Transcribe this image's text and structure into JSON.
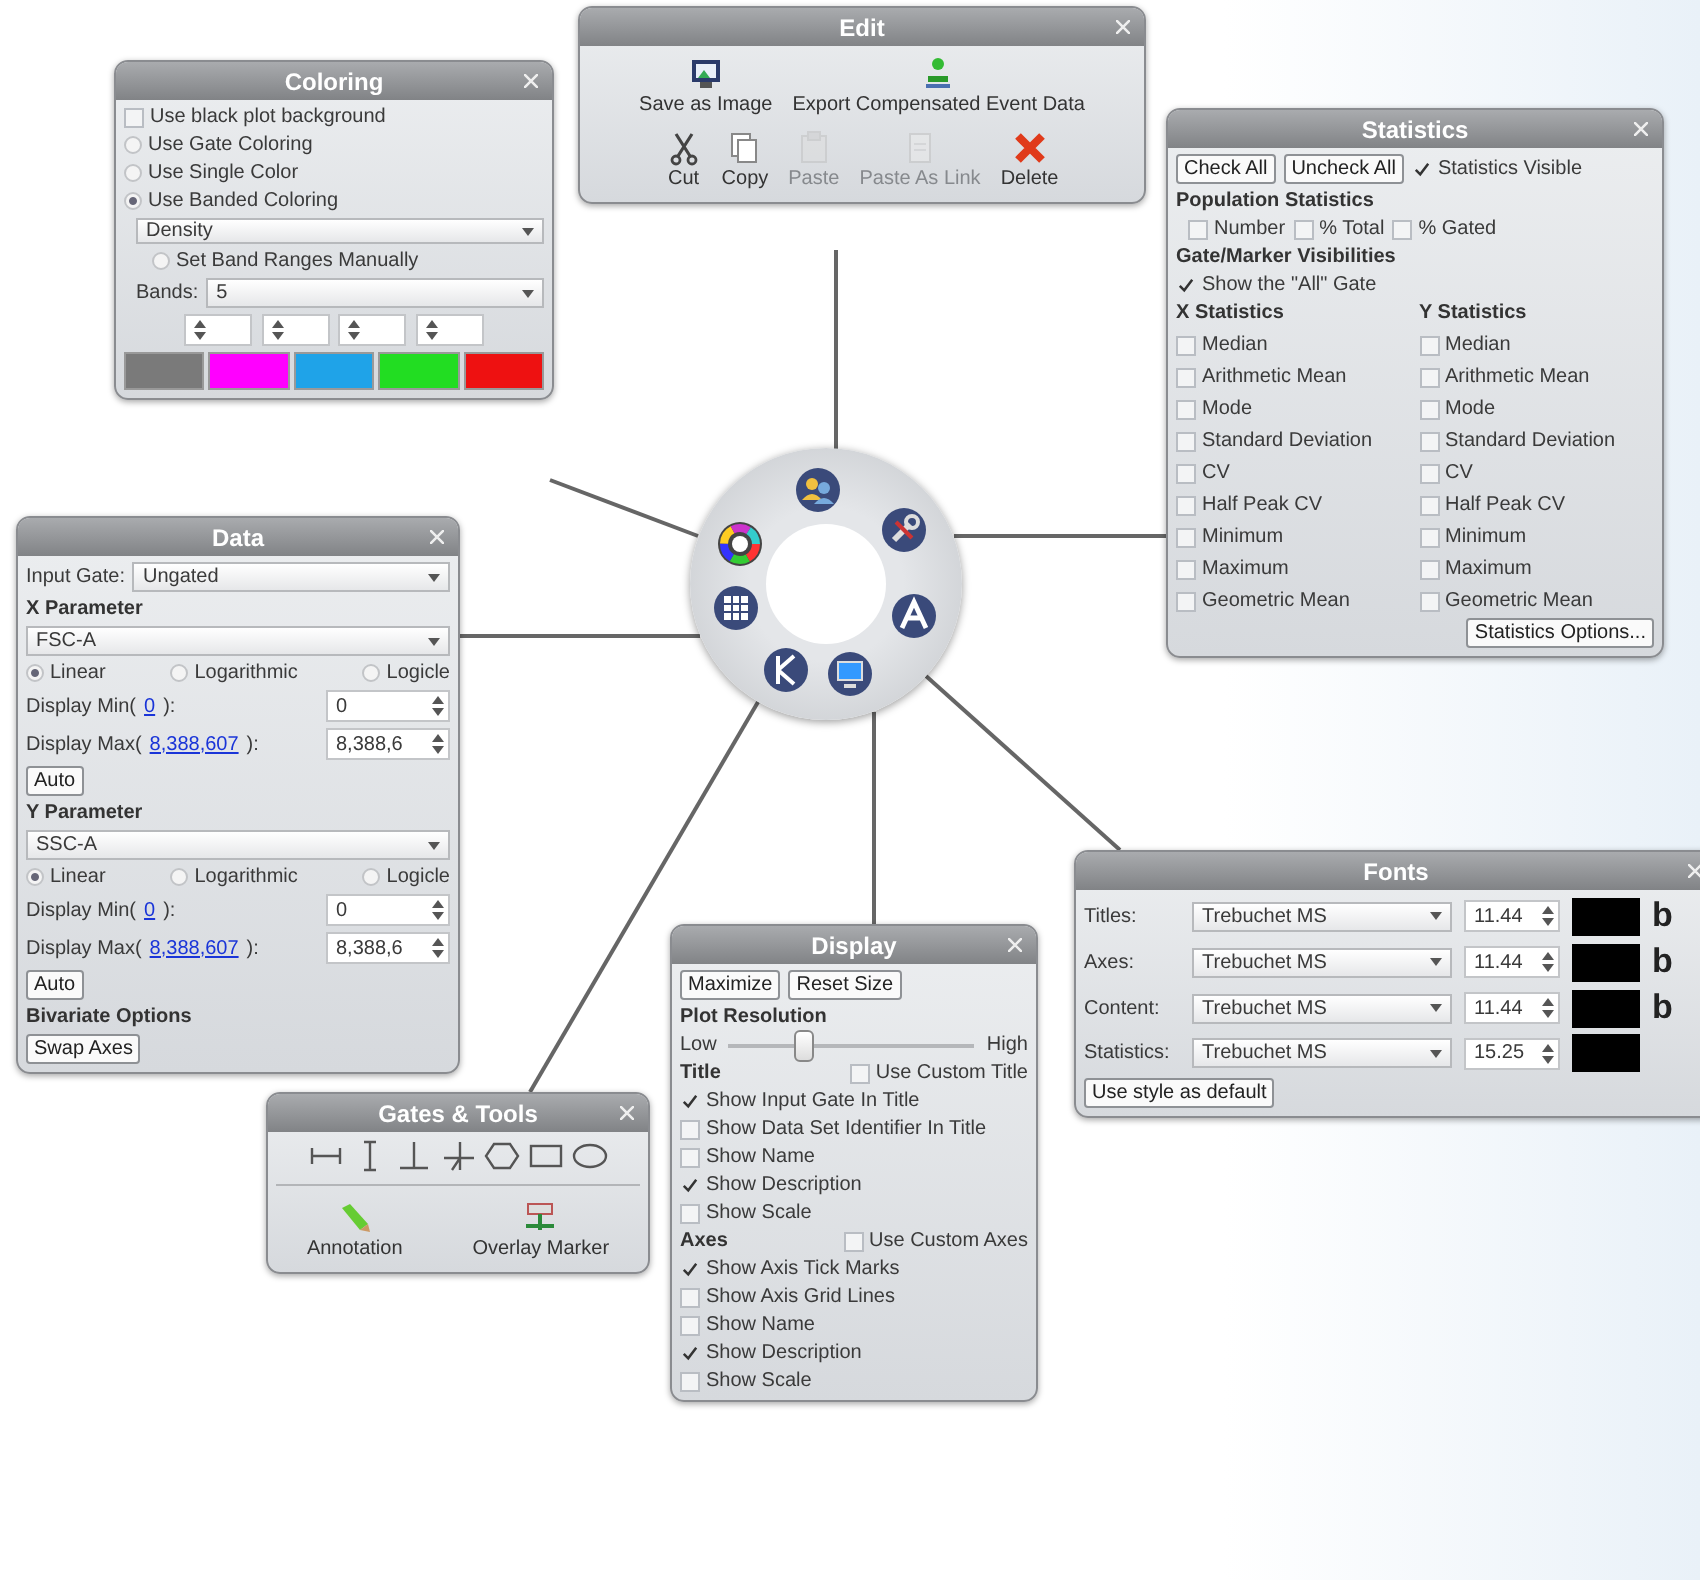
{
  "panels": [
    {
      "kind": "edit",
      "title": "Edit",
      "groups": [
        {
          "actions": [
            {
              "kind": "image",
              "label": "Save as Image",
              "disabled": false
            },
            {
              "kind": "export",
              "label": "Export Compensated Event Data",
              "disabled": false
            }
          ]
        },
        {
          "actions": [
            {
              "kind": "cut",
              "label": "Cut",
              "disabled": false
            },
            {
              "kind": "copy",
              "label": "Copy",
              "disabled": false
            },
            {
              "kind": "paste",
              "label": "Paste",
              "disabled": true
            },
            {
              "kind": "link",
              "label": "Paste As Link",
              "disabled": true
            },
            {
              "kind": "delete",
              "label": "Delete",
              "disabled": false
            }
          ]
        }
      ]
    },
    {
      "kind": "coloring",
      "title": "Coloring",
      "options": [
        {
          "kind": "checkbox",
          "label": "Use black plot background",
          "checked": false
        },
        {
          "kind": "radio",
          "label": "Use Gate Coloring",
          "selected": false
        },
        {
          "kind": "radio",
          "label": "Use Single Color",
          "selected": false
        },
        {
          "kind": "radio",
          "label": "Use Banded Coloring",
          "selected": true
        }
      ],
      "band_type": "Density",
      "manual": {
        "kind": "radio",
        "label": "Set Band Ranges Manually",
        "selected": false
      },
      "bands_label": "Bands:",
      "bands_value": "5",
      "swatches": [
        {
          "color": "#7a7a7a"
        },
        {
          "color": "#ff00ff"
        },
        {
          "color": "#1fa3e8"
        },
        {
          "color": "#22dd22"
        },
        {
          "color": "#ee1111"
        }
      ]
    },
    {
      "kind": "statistics",
      "title": "Statistics",
      "buttons": [
        "Check All",
        "Uncheck All"
      ],
      "visible": {
        "label": "Statistics Visible",
        "checked": true
      },
      "population": {
        "heading": "Population Statistics",
        "items": [
          {
            "label": "Number",
            "checked": false
          },
          {
            "label": "% Total",
            "checked": false
          },
          {
            "label": "% Gated",
            "checked": false
          }
        ]
      },
      "gates": {
        "heading": "Gate/Marker Visibilities",
        "items": [
          {
            "label": "Show the \"All\" Gate",
            "checked": true
          }
        ]
      },
      "columns": [
        {
          "heading": "X Statistics",
          "items": [
            {
              "label": "Median",
              "checked": false
            },
            {
              "label": "Arithmetic Mean",
              "checked": false
            },
            {
              "label": "Mode",
              "checked": false
            },
            {
              "label": "Standard Deviation",
              "checked": false
            },
            {
              "label": "CV",
              "checked": false
            },
            {
              "label": "Half Peak CV",
              "checked": false
            },
            {
              "label": "Minimum",
              "checked": false
            },
            {
              "label": "Maximum",
              "checked": false
            },
            {
              "label": "Geometric Mean",
              "checked": false
            }
          ]
        },
        {
          "heading": "Y Statistics",
          "items": [
            {
              "label": "Median",
              "checked": false
            },
            {
              "label": "Arithmetic Mean",
              "checked": false
            },
            {
              "label": "Mode",
              "checked": false
            },
            {
              "label": "Standard Deviation",
              "checked": false
            },
            {
              "label": "CV",
              "checked": false
            },
            {
              "label": "Half Peak CV",
              "checked": false
            },
            {
              "label": "Minimum",
              "checked": false
            },
            {
              "label": "Maximum",
              "checked": false
            },
            {
              "label": "Geometric Mean",
              "checked": false
            }
          ]
        }
      ],
      "options_button": "Statistics Options..."
    },
    {
      "kind": "data",
      "title": "Data",
      "input_gate": {
        "label": "Input Gate:",
        "value": "Ungated"
      },
      "parameters": [
        {
          "heading": "X Parameter",
          "value": "FSC-A",
          "scales": [
            {
              "label": "Linear",
              "selected": true
            },
            {
              "label": "Logarithmic",
              "selected": false
            },
            {
              "label": "Logicle",
              "selected": false
            }
          ],
          "limits": [
            {
              "label": "Display Min(",
              "link": "0",
              "close": "):",
              "value": "0"
            },
            {
              "label": "Display Max(",
              "link": "8,388,607",
              "close": "):",
              "value": "8,388,6"
            }
          ],
          "auto": "Auto"
        },
        {
          "heading": "Y Parameter",
          "value": "SSC-A",
          "scales": [
            {
              "label": "Linear",
              "selected": true
            },
            {
              "label": "Logarithmic",
              "selected": false
            },
            {
              "label": "Logicle",
              "selected": false
            }
          ],
          "limits": [
            {
              "label": "Display Min(",
              "link": "0",
              "close": "):",
              "value": "0"
            },
            {
              "label": "Display Max(",
              "link": "8,388,607",
              "close": "):",
              "value": "8,388,6"
            }
          ],
          "auto": "Auto"
        }
      ],
      "bivariate": {
        "heading": "Bivariate Options",
        "button": "Swap Axes"
      }
    },
    {
      "kind": "fonts",
      "title": "Fonts",
      "rows": [
        {
          "label": "Titles:",
          "font": "Trebuchet MS",
          "size": "11.44",
          "sample": "b"
        },
        {
          "label": "Axes:",
          "font": "Trebuchet MS",
          "size": "11.44",
          "sample": "b"
        },
        {
          "label": "Content:",
          "font": "Trebuchet MS",
          "size": "11.44",
          "sample": "b"
        },
        {
          "label": "Statistics:",
          "font": "Trebuchet MS",
          "size": "15.25"
        }
      ],
      "button": "Use style as default"
    },
    {
      "kind": "gates",
      "title": "Gates & Tools",
      "tools": [
        {
          "kind": "interval"
        },
        {
          "kind": "ibeam"
        },
        {
          "kind": "invt"
        },
        {
          "kind": "cross"
        },
        {
          "kind": "hexagon"
        },
        {
          "kind": "rectangle"
        },
        {
          "kind": "ellipse"
        }
      ],
      "actions": [
        {
          "kind": "annotation",
          "label": "Annotation"
        },
        {
          "kind": "overlay",
          "label": "Overlay Marker"
        }
      ]
    },
    {
      "kind": "display",
      "title": "Display",
      "buttons": [
        "Maximize",
        "Reset Size"
      ],
      "resolution": {
        "heading": "Plot Resolution",
        "low": "Low",
        "high": "High",
        "level": 0.3
      },
      "sections": [
        {
          "heading": "Title",
          "custom": {
            "label": "Use Custom Title",
            "checked": false
          },
          "items": [
            {
              "label": "Show Input Gate In Title",
              "checked": true
            },
            {
              "label": "Show Data Set Identifier In Title",
              "checked": false
            },
            {
              "label": "Show Name",
              "checked": false
            },
            {
              "label": "Show Description",
              "checked": true
            },
            {
              "label": "Show Scale",
              "checked": false
            }
          ]
        },
        {
          "heading": "Axes",
          "custom": {
            "label": "Use Custom Axes",
            "checked": false
          },
          "items": [
            {
              "label": "Show Axis Tick Marks",
              "checked": true
            },
            {
              "label": "Show Axis Grid Lines",
              "checked": false
            },
            {
              "label": "Show Name",
              "checked": false
            },
            {
              "label": "Show Description",
              "checked": true
            },
            {
              "label": "Show Scale",
              "checked": false
            }
          ]
        }
      ]
    }
  ]
}
